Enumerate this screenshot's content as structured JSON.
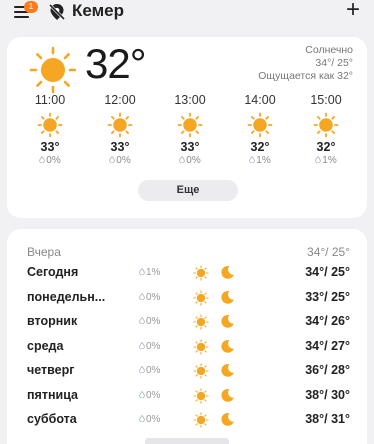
{
  "header": {
    "menu_icon": "menu-icon",
    "badge": "1",
    "location_icon": "location-off-icon",
    "city": "Кемер",
    "add_icon": "plus-icon",
    "add_label": "+"
  },
  "current": {
    "icon": "sun-icon",
    "temperature": "32°",
    "condition": "Солнечно",
    "high_low": "34°/ 25°",
    "feels_like": "Ощущается как 32°"
  },
  "hourly": [
    {
      "time": "11:00",
      "icon": "sun-icon",
      "temp": "33°",
      "precip": "0%"
    },
    {
      "time": "12:00",
      "icon": "sun-icon",
      "temp": "33°",
      "precip": "0%"
    },
    {
      "time": "13:00",
      "icon": "sun-icon",
      "temp": "33°",
      "precip": "0%"
    },
    {
      "time": "14:00",
      "icon": "sun-icon",
      "temp": "32°",
      "precip": "1%"
    },
    {
      "time": "15:00",
      "icon": "sun-icon",
      "temp": "32°",
      "precip": "1%"
    }
  ],
  "more_button": "Еще",
  "yesterday": {
    "label": "Вчера",
    "temps": "34°/ 25°"
  },
  "daily": [
    {
      "day": "Сегодня",
      "precip": "1%",
      "temps": "34°/ 25°"
    },
    {
      "day": "понедельн...",
      "precip": "0%",
      "temps": "33°/ 25°"
    },
    {
      "day": "вторник",
      "precip": "0%",
      "temps": "34°/ 26°"
    },
    {
      "day": "среда",
      "precip": "0%",
      "temps": "34°/ 27°"
    },
    {
      "day": "четверг",
      "precip": "0%",
      "temps": "36°/ 28°"
    },
    {
      "day": "пятница",
      "precip": "0%",
      "temps": "38°/ 30°"
    },
    {
      "day": "суббота",
      "precip": "0%",
      "temps": "38°/ 31°"
    }
  ],
  "colors": {
    "sun": "#f5a623",
    "badge": "#ff7a1a",
    "background": "#f1f1f4"
  }
}
